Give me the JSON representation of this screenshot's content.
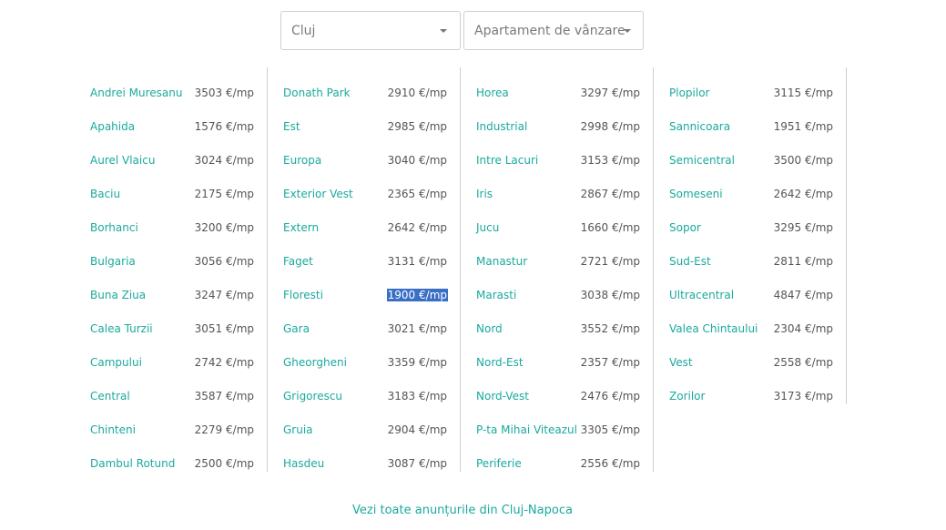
{
  "filters": {
    "city": "Cluj",
    "property_type": "Apartament de vânzare"
  },
  "columns": [
    [
      {
        "name": "Andrei Muresanu",
        "price": "3503 €/mp"
      },
      {
        "name": "Apahida",
        "price": "1576 €/mp"
      },
      {
        "name": "Aurel Vlaicu",
        "price": "3024 €/mp"
      },
      {
        "name": "Baciu",
        "price": "2175 €/mp"
      },
      {
        "name": "Borhanci",
        "price": "3200 €/mp"
      },
      {
        "name": "Bulgaria",
        "price": "3056 €/mp"
      },
      {
        "name": "Buna Ziua",
        "price": "3247 €/mp"
      },
      {
        "name": "Calea Turzii",
        "price": "3051 €/mp"
      },
      {
        "name": "Campului",
        "price": "2742 €/mp"
      },
      {
        "name": "Central",
        "price": "3587 €/mp"
      },
      {
        "name": "Chinteni",
        "price": "2279 €/mp"
      },
      {
        "name": "Dambul Rotund",
        "price": "2500 €/mp"
      }
    ],
    [
      {
        "name": "Donath Park",
        "price": "2910 €/mp"
      },
      {
        "name": "Est",
        "price": "2985 €/mp"
      },
      {
        "name": "Europa",
        "price": "3040 €/mp"
      },
      {
        "name": "Exterior Vest",
        "price": "2365 €/mp"
      },
      {
        "name": "Extern",
        "price": "2642 €/mp"
      },
      {
        "name": "Faget",
        "price": "3131 €/mp"
      },
      {
        "name": "Floresti",
        "price": "1900 €/mp",
        "selected": true
      },
      {
        "name": "Gara",
        "price": "3021 €/mp"
      },
      {
        "name": "Gheorgheni",
        "price": "3359 €/mp"
      },
      {
        "name": "Grigorescu",
        "price": "3183 €/mp"
      },
      {
        "name": "Gruia",
        "price": "2904 €/mp"
      },
      {
        "name": "Hasdeu",
        "price": "3087 €/mp"
      }
    ],
    [
      {
        "name": "Horea",
        "price": "3297 €/mp"
      },
      {
        "name": "Industrial",
        "price": "2998 €/mp"
      },
      {
        "name": "Intre Lacuri",
        "price": "3153 €/mp"
      },
      {
        "name": "Iris",
        "price": "2867 €/mp"
      },
      {
        "name": "Jucu",
        "price": "1660 €/mp"
      },
      {
        "name": "Manastur",
        "price": "2721 €/mp"
      },
      {
        "name": "Marasti",
        "price": "3038 €/mp"
      },
      {
        "name": "Nord",
        "price": "3552 €/mp"
      },
      {
        "name": "Nord-Est",
        "price": "2357 €/mp"
      },
      {
        "name": "Nord-Vest",
        "price": "2476 €/mp"
      },
      {
        "name": "P-ta Mihai Viteazul",
        "price": "3305 €/mp"
      },
      {
        "name": "Periferie",
        "price": "2556 €/mp"
      }
    ],
    [
      {
        "name": "Plopilor",
        "price": "3115 €/mp"
      },
      {
        "name": "Sannicoara",
        "price": "1951 €/mp"
      },
      {
        "name": "Semicentral",
        "price": "3500 €/mp"
      },
      {
        "name": "Someseni",
        "price": "2642 €/mp"
      },
      {
        "name": "Sopor",
        "price": "3295 €/mp"
      },
      {
        "name": "Sud-Est",
        "price": "2811 €/mp"
      },
      {
        "name": "Ultracentral",
        "price": "4847 €/mp"
      },
      {
        "name": "Valea Chintaului",
        "price": "2304 €/mp"
      },
      {
        "name": "Vest",
        "price": "2558 €/mp"
      },
      {
        "name": "Zorilor",
        "price": "3173 €/mp"
      }
    ]
  ],
  "footer": {
    "link_label": "Vezi toate anunțurile din Cluj-Napoca"
  },
  "colors": {
    "link": "#1aaa9c",
    "selection": "#3a6fc6"
  }
}
